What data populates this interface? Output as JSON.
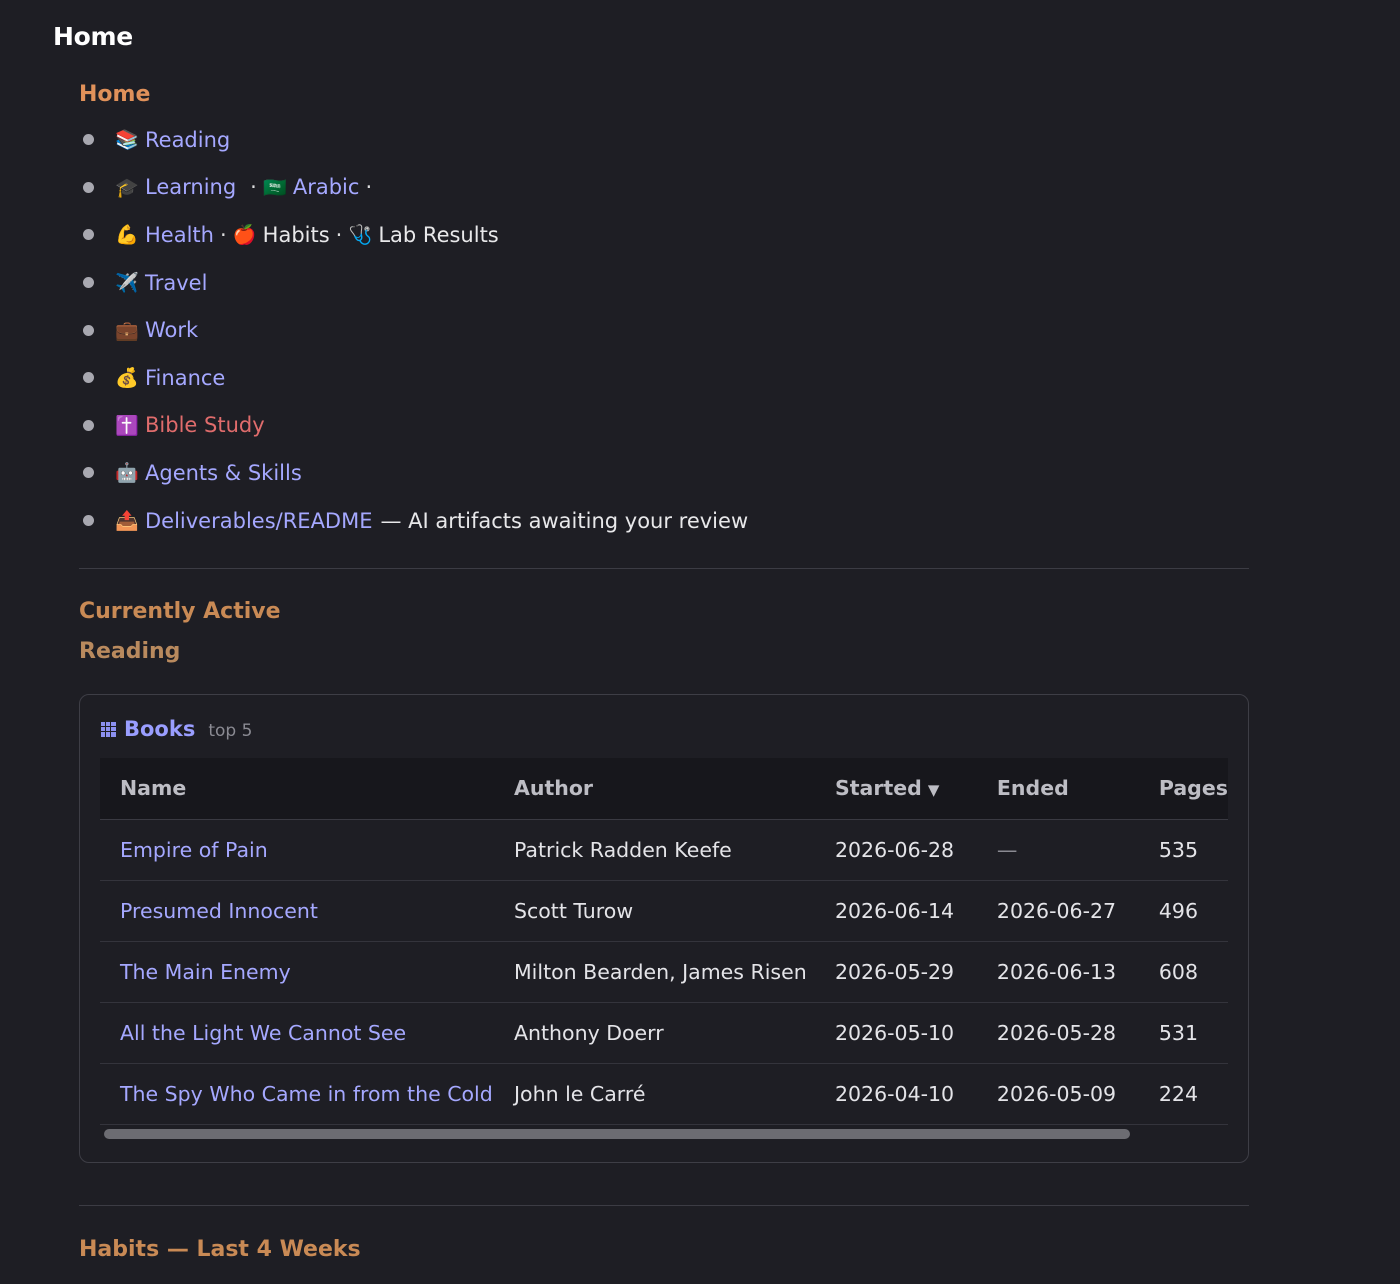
{
  "page": {
    "title": "Home"
  },
  "home_section": {
    "heading": "Home",
    "items": [
      {
        "emoji": "📚",
        "label": "Reading"
      },
      {
        "emoji": "🎓",
        "label": "Learning",
        "sep1": "·",
        "emoji2": "🇸🇦",
        "label2": "Arabic",
        "sep2": "·"
      },
      {
        "emoji": "💪",
        "label": "Health",
        "sep1": "·",
        "emoji2": "🍎",
        "label2": "Habits",
        "sep2": "·",
        "emoji3": "🩺",
        "label3": "Lab Results"
      },
      {
        "emoji": "✈️",
        "label": "Travel"
      },
      {
        "emoji": "💼",
        "label": "Work"
      },
      {
        "emoji": "💰",
        "label": "Finance"
      },
      {
        "emoji": "✝️",
        "label": "Bible Study"
      },
      {
        "emoji": "🤖",
        "label": "Agents & Skills"
      },
      {
        "emoji": "📤",
        "label": "Deliverables/README",
        "suffix": "— AI artifacts awaiting your review"
      }
    ]
  },
  "currently_active": {
    "heading": "Currently Active",
    "subheading": "Reading"
  },
  "books_card": {
    "title": "Books",
    "meta": "top 5",
    "columns": [
      "Name",
      "Author",
      "Started",
      "Ended",
      "Pages"
    ],
    "sort_indicator": "▼",
    "rows": [
      {
        "name": "Empire of Pain",
        "author": "Patrick Radden Keefe",
        "started": "2026-06-28",
        "ended": "—",
        "pages": "535"
      },
      {
        "name": "Presumed Innocent",
        "author": "Scott Turow",
        "started": "2026-06-14",
        "ended": "2026-06-27",
        "pages": "496"
      },
      {
        "name": "The Main Enemy",
        "author": "Milton Bearden, James Risen",
        "started": "2026-05-29",
        "ended": "2026-06-13",
        "pages": "608"
      },
      {
        "name": "All the Light We Cannot See",
        "author": "Anthony Doerr",
        "started": "2026-05-10",
        "ended": "2026-05-28",
        "pages": "531"
      },
      {
        "name": "The Spy Who Came in from the Cold",
        "author": "John le Carré",
        "started": "2026-04-10",
        "ended": "2026-05-09",
        "pages": "224"
      }
    ]
  },
  "habits_section": {
    "heading": "Habits — Last 4 Weeks"
  }
}
